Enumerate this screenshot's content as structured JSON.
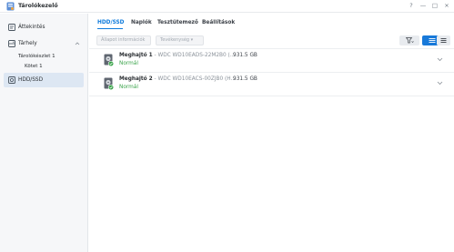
{
  "window": {
    "title": "Tárolókezelő",
    "help_label": "?",
    "minimize_label": "—",
    "maximize_label": "□",
    "close_label": "×"
  },
  "sidebar": {
    "items": [
      {
        "label": "Áttekintés",
        "icon": "overview-icon"
      },
      {
        "label": "Tárhely",
        "icon": "storage-icon"
      },
      {
        "label": "HDD/SSD",
        "icon": "hdd-icon"
      }
    ],
    "sub_items": [
      {
        "label": "Tárolókészlet 1"
      },
      {
        "label": "Kötet 1"
      }
    ]
  },
  "tabs": [
    {
      "label": "HDD/SSD",
      "active": true
    },
    {
      "label": "Naplók"
    },
    {
      "label": "Tesztütemező"
    },
    {
      "label": "Beállítások"
    }
  ],
  "toolbar": {
    "info_label": "Állapot információk",
    "action_label": "Tevékenység ▾"
  },
  "drives": [
    {
      "name": "Meghajtó 1",
      "model": " - WDC WD10EADS-22M2B0 (...",
      "size": "931.5 GB",
      "status": "Normál"
    },
    {
      "name": "Meghajtó 2",
      "model": " - WDC WD10EACS-00ZJB0 (H...",
      "size": "931.5 GB",
      "status": "Normál"
    }
  ],
  "colors": {
    "accent": "#0f7bdc",
    "status_ok": "#3aa34a",
    "active_item_bg": "#dde7f3"
  }
}
